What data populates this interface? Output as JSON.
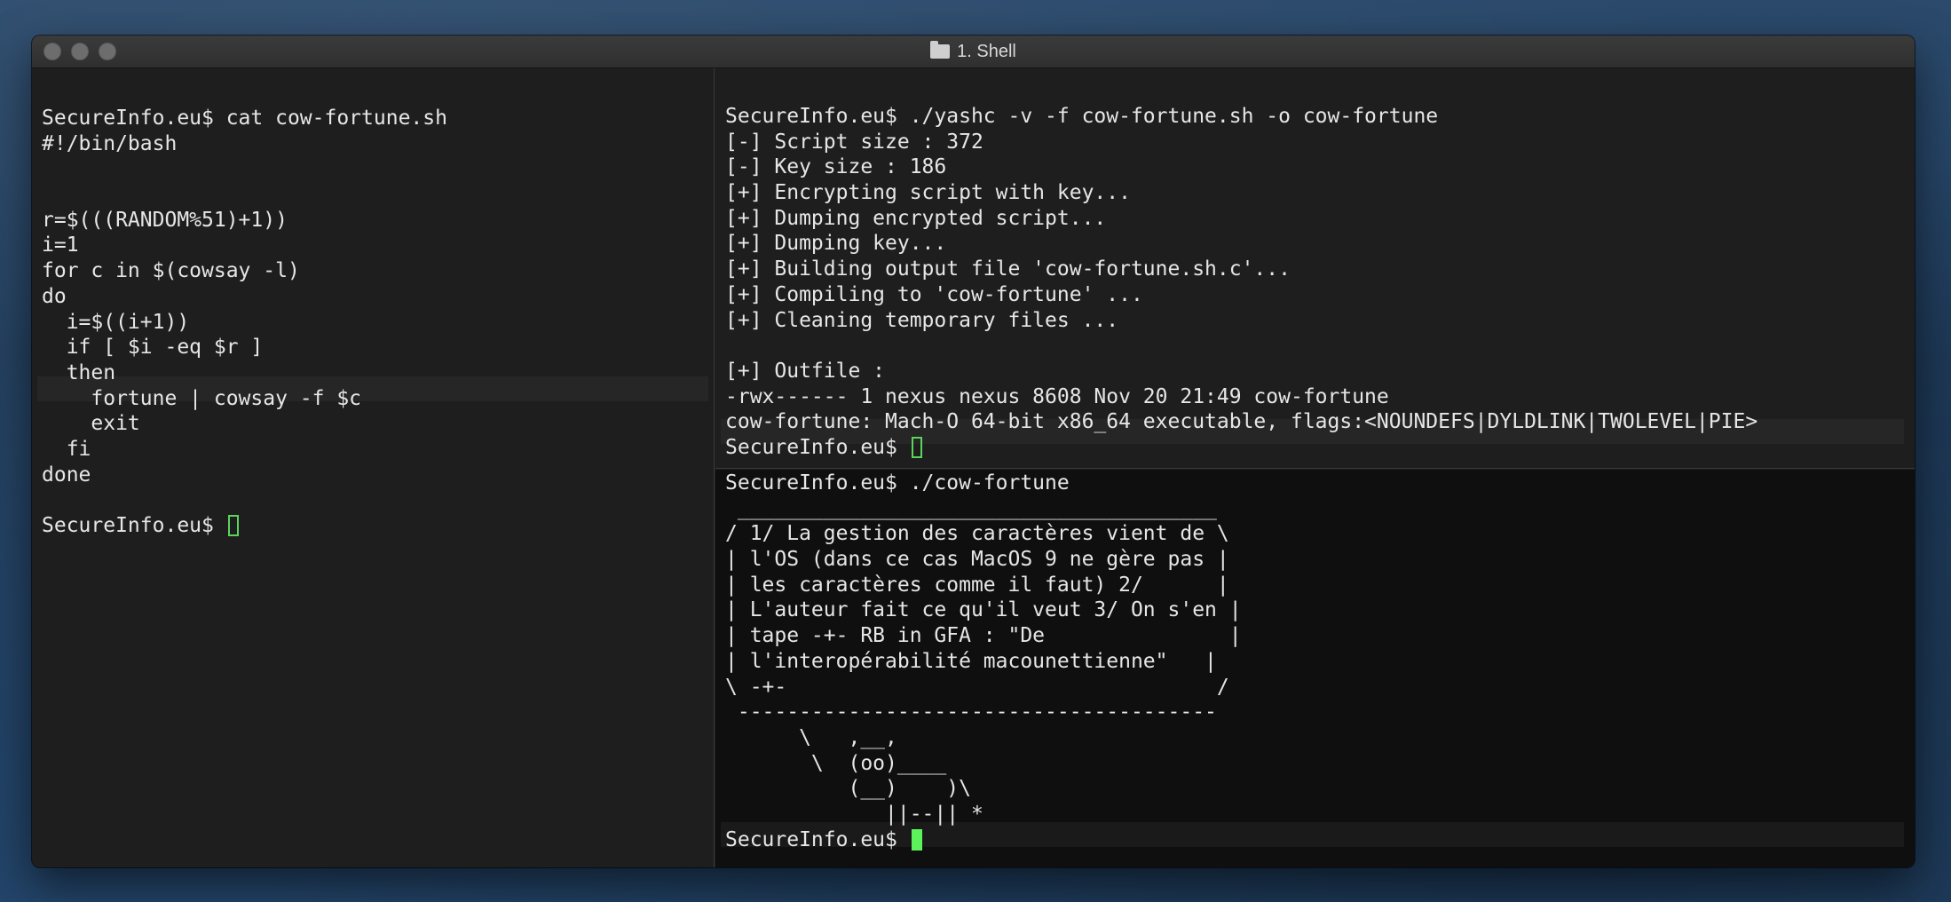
{
  "window": {
    "title": "1. Shell"
  },
  "left_pane": {
    "lines": [
      "SecureInfo.eu$ cat cow-fortune.sh",
      "#!/bin/bash",
      "",
      "",
      "r=$(((RANDOM%51)+1))",
      "i=1",
      "for c in $(cowsay -l)",
      "do",
      "  i=$((i+1))",
      "  if [ $i -eq $r ]",
      "  then",
      "    fortune | cowsay -f $c",
      "    exit",
      "  fi",
      "done",
      ""
    ],
    "prompt": "SecureInfo.eu$ "
  },
  "top_right_pane": {
    "lines": [
      "SecureInfo.eu$ ./yashc -v -f cow-fortune.sh -o cow-fortune",
      "[-] Script size : 372",
      "[-] Key size : 186",
      "[+] Encrypting script with key...",
      "[+] Dumping encrypted script...",
      "[+] Dumping key...",
      "[+] Building output file 'cow-fortune.sh.c'...",
      "[+] Compiling to 'cow-fortune' ...",
      "[+] Cleaning temporary files ...",
      "",
      "[+] Outfile :",
      "-rwx------ 1 nexus nexus 8608 Nov 20 21:49 cow-fortune",
      "cow-fortune: Mach-O 64-bit x86_64 executable, flags:<NOUNDEFS|DYLDLINK|TWOLEVEL|PIE>"
    ],
    "prompt": "SecureInfo.eu$ "
  },
  "bottom_right_pane": {
    "lines": [
      "SecureInfo.eu$ ./cow-fortune",
      " _______________________________________",
      "/ 1/ La gestion des caractères vient de \\",
      "| l'OS (dans ce cas MacOS 9 ne gère pas |",
      "| les caractères comme il faut) 2/      |",
      "| L'auteur fait ce qu'il veut 3/ On s'en |",
      "| tape -+- RB in GFA : \"De               |",
      "| l'interopérabilité macounettienne\"   |",
      "\\ -+-                                   /",
      " ---------------------------------------",
      "      \\   ,__,",
      "       \\  (oo)____",
      "          (__)    )\\",
      "             ||--|| *"
    ],
    "prompt": "SecureInfo.eu$ "
  },
  "colors": {
    "cursor": "#5cf25c",
    "text": "#e6e6e6",
    "background": "#1e1e1e"
  }
}
